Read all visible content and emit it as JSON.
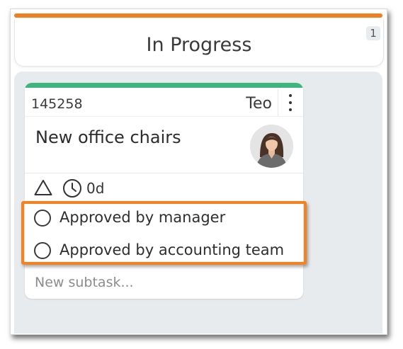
{
  "column": {
    "title": "In Progress",
    "count": "1",
    "accent_color": "#f07f23"
  },
  "card": {
    "id": "145258",
    "assignee": "Teo",
    "title": "New office chairs",
    "accent_color": "#3fb57e",
    "menu_icon": "vertical-ellipsis-icon",
    "avatar_icon": "user-avatar",
    "meta": {
      "priority_icon": "warning-triangle-icon",
      "time_icon": "clock-icon",
      "due": "0d"
    },
    "subtasks": [
      {
        "label": "Approved by manager",
        "done": false
      },
      {
        "label": "Approved by accounting team",
        "done": false
      }
    ],
    "new_subtask_placeholder": "New subtask..."
  },
  "highlight_color": "#f58220"
}
